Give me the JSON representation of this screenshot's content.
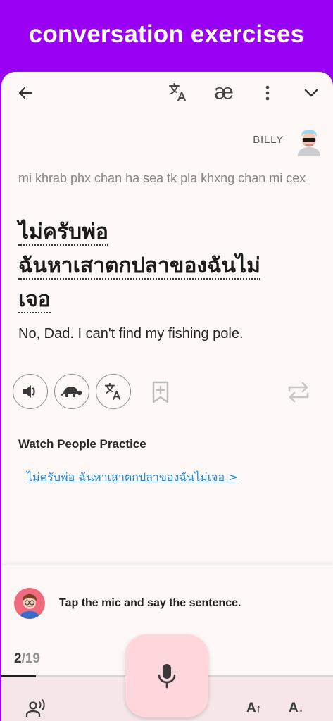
{
  "banner": {
    "title": "conversation exercises"
  },
  "toolbar": {
    "back_icon": "arrow-left-icon",
    "translate_icon": "translate-icon",
    "ipa_label": "æ",
    "more_icon": "more-vert-icon",
    "collapse_icon": "chevron-down-icon"
  },
  "speaker": {
    "name": "BILLY",
    "avatar": "billy-avatar"
  },
  "sentence": {
    "transliteration": "mi khrab phx chan ha sea tk pla khxng chan mi cex",
    "thai_lines": [
      "ไม่ครับพ่อ",
      "ฉันหาเสาตกปลาของฉันไม่",
      "เจอ"
    ],
    "english": "No, Dad. I can't find my fishing pole."
  },
  "actions": {
    "play": "volume-icon",
    "slow": "turtle-icon",
    "translate": "translate-icon",
    "bookmark": "bookmark-add-icon",
    "repeat": "repeat-icon"
  },
  "watch": {
    "title": "Watch People Practice",
    "link": "ไม่ครับพ่อ ฉันหาเสาตกปลาของฉันไม่เจอ >"
  },
  "prompt": {
    "text": "Tap the mic and say the sentence."
  },
  "progress": {
    "current": "2",
    "total": "/19",
    "fraction": 0.105
  },
  "bottom": {
    "voice_icon": "voice-settings-icon",
    "mic_icon": "microphone-icon",
    "font_up": "A",
    "font_down": "A"
  },
  "colors": {
    "accent": "#9a00f4",
    "link": "#1c8ad6",
    "mic_bg": "#ffd6dc"
  }
}
